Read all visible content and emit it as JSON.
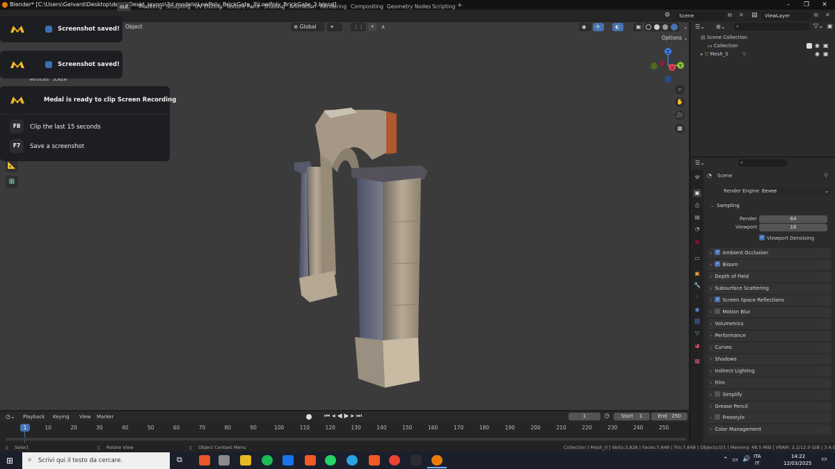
{
  "window": {
    "title": "Blender* [C:\\Users\\Gelvard\\Desktop\\deskt\\Deskt_lavoro\\3d models\\LowPoly_BrickGate_3\\LowPoly_BrickGate_3.blend]",
    "scene": "Scene",
    "view_layer": "ViewLayer"
  },
  "workspaces": [
    "out",
    "Modeling",
    "Sculpting",
    "UV Editing",
    "Texture Paint",
    "Shading",
    "Animation",
    "Rendering",
    "Compositing",
    "Geometry Nodes",
    "Scripting",
    "+"
  ],
  "viewport": {
    "mode_label": "Object",
    "transform_orientation": "Global",
    "options_label": "Options",
    "stats": {
      "vertices_label": "Vertices",
      "vertices_value": "3,826"
    }
  },
  "medal": {
    "toast1": "Screenshot saved!",
    "toast2": "Screenshot saved!",
    "panel_title": "Medal is ready to clip Screen Recording",
    "shortcuts": [
      {
        "key": "F8",
        "label": "Clip the last 15 seconds"
      },
      {
        "key": "F7",
        "label": "Save a screenshot"
      }
    ]
  },
  "outliner": {
    "root": "Scene Collection",
    "items": [
      {
        "label": "Collection"
      },
      {
        "label": "Mesh_0"
      }
    ]
  },
  "properties": {
    "context": "Scene",
    "render_engine_label": "Render Engine",
    "render_engine_value": "Eevee",
    "sampling": {
      "title": "Sampling",
      "render_label": "Render",
      "render_value": "64",
      "viewport_label": "Viewport",
      "viewport_value": "16",
      "denoise_label": "Viewport Denoising"
    },
    "sections": [
      {
        "label": "Ambient Occlusion",
        "checkbox": true,
        "checked": true
      },
      {
        "label": "Bloom",
        "checkbox": true,
        "checked": true
      },
      {
        "label": "Depth of Field",
        "checkbox": false
      },
      {
        "label": "Subsurface Scattering",
        "checkbox": false
      },
      {
        "label": "Screen Space Reflections",
        "checkbox": true,
        "checked": true
      },
      {
        "label": "Motion Blur",
        "checkbox": true,
        "checked": false
      },
      {
        "label": "Volumetrics",
        "checkbox": false
      },
      {
        "label": "Performance",
        "checkbox": false
      },
      {
        "label": "Curves",
        "checkbox": false
      },
      {
        "label": "Shadows",
        "checkbox": false
      },
      {
        "label": "Indirect Lighting",
        "checkbox": false
      },
      {
        "label": "Film",
        "checkbox": false
      },
      {
        "label": "Simplify",
        "checkbox": true,
        "checked": false
      },
      {
        "label": "Grease Pencil",
        "checkbox": false
      },
      {
        "label": "Freestyle",
        "checkbox": true,
        "checked": false
      },
      {
        "label": "Color Management",
        "checkbox": false
      }
    ]
  },
  "timeline": {
    "menus": [
      "Playback",
      "Keying",
      "View",
      "Marker"
    ],
    "current_frame": "1",
    "start_label": "Start",
    "start_value": "1",
    "end_label": "End",
    "end_value": "250",
    "ticks": [
      "1",
      "10",
      "20",
      "30",
      "40",
      "50",
      "60",
      "70",
      "80",
      "90",
      "100",
      "110",
      "120",
      "130",
      "140",
      "150",
      "160",
      "170",
      "180",
      "190",
      "200",
      "210",
      "220",
      "230",
      "240",
      "250"
    ]
  },
  "statusbar": {
    "select": "Select",
    "rotate": "Rotate View",
    "context_menu": "Object Context Menu",
    "info": "Collection | Mesh_0 | Verts:3,826 | Faces:7,648 | Tris:7,648 | Objects:0/1 | Memory: 48.5 MiB | VRAM: 2.2/12.0 GiB | 3.4.0"
  },
  "taskbar": {
    "search_placeholder": "Scrivi qui il testo da cercare.",
    "lang_line1": "ITA",
    "lang_line2": "IT",
    "time": "14:22",
    "date": "12/03/2025"
  }
}
